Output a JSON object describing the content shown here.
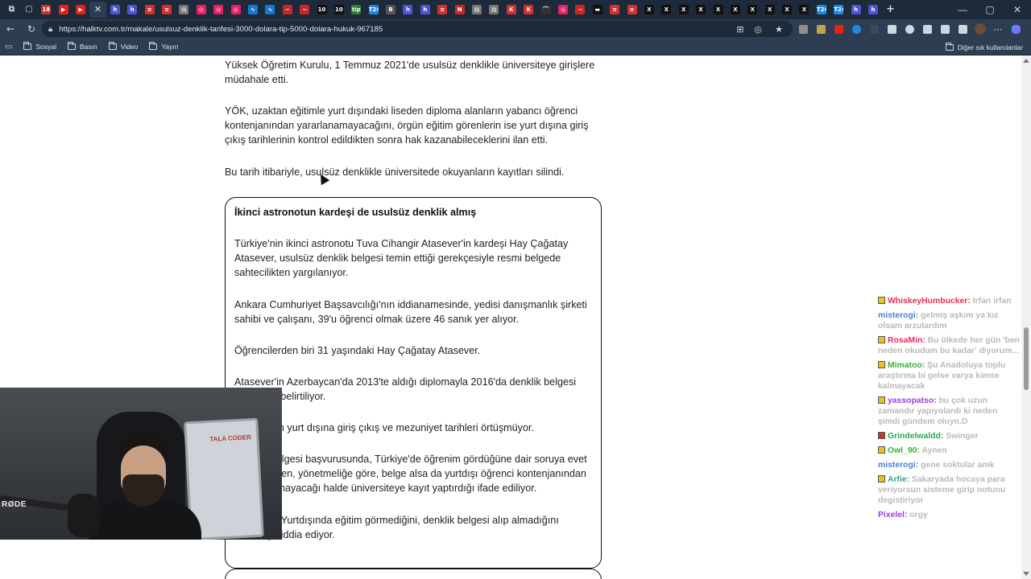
{
  "browser": {
    "url": "https://halktv.com.tr/makale/usulsuz-denklik-tarifesi-3000-dolara-tip-5000-dolara-hukuk-967185",
    "tabs": [
      {
        "glyph": "18",
        "color": "#c0392b"
      },
      {
        "glyph": "▶",
        "color": "#e62117"
      },
      {
        "glyph": "▶",
        "color": "#e62117"
      },
      {
        "glyph": "✕",
        "color": "transparent",
        "active": true
      },
      {
        "glyph": "h",
        "color": "#4a55d6"
      },
      {
        "glyph": "h",
        "color": "#4a55d6"
      },
      {
        "glyph": "≡",
        "color": "#d32f2f"
      },
      {
        "glyph": "≡",
        "color": "#d32f2f"
      },
      {
        "glyph": "▤",
        "color": "#777"
      },
      {
        "glyph": "◎",
        "color": "#e91e63"
      },
      {
        "glyph": "◎",
        "color": "#e91e63"
      },
      {
        "glyph": "◎",
        "color": "#e91e63"
      },
      {
        "glyph": "∿",
        "color": "#1976d2"
      },
      {
        "glyph": "∿",
        "color": "#1976d2"
      },
      {
        "glyph": "~",
        "color": "#c62828"
      },
      {
        "glyph": "~",
        "color": "#c62828"
      },
      {
        "glyph": "10",
        "color": "#111"
      },
      {
        "glyph": "10",
        "color": "#111"
      },
      {
        "glyph": "tip",
        "color": "#2e7d32"
      },
      {
        "glyph": "T24",
        "color": "#1e88e5"
      },
      {
        "glyph": "B",
        "color": "#555"
      },
      {
        "glyph": "h",
        "color": "#4a55d6"
      },
      {
        "glyph": "h",
        "color": "#4a55d6"
      },
      {
        "glyph": "≡",
        "color": "#d32f2f"
      },
      {
        "glyph": "N",
        "color": "#c62828"
      },
      {
        "glyph": "▤",
        "color": "#777"
      },
      {
        "glyph": "▤",
        "color": "#777"
      },
      {
        "glyph": "K",
        "color": "#d32f2f"
      },
      {
        "glyph": "K",
        "color": "#d32f2f"
      },
      {
        "glyph": "⌒",
        "color": "#333"
      },
      {
        "glyph": "◎",
        "color": "#e91e63"
      },
      {
        "glyph": "~",
        "color": "#c62828"
      },
      {
        "glyph": "▬",
        "color": "#111"
      },
      {
        "glyph": "≡",
        "color": "#d32f2f"
      },
      {
        "glyph": "≡",
        "color": "#d32f2f"
      },
      {
        "glyph": "X",
        "color": "#111"
      },
      {
        "glyph": "X",
        "color": "#111"
      },
      {
        "glyph": "X",
        "color": "#111"
      },
      {
        "glyph": "X",
        "color": "#111"
      },
      {
        "glyph": "X",
        "color": "#111"
      },
      {
        "glyph": "X",
        "color": "#111"
      },
      {
        "glyph": "X",
        "color": "#111"
      },
      {
        "glyph": "X",
        "color": "#111"
      },
      {
        "glyph": "X",
        "color": "#111"
      },
      {
        "glyph": "X",
        "color": "#111"
      },
      {
        "glyph": "T24",
        "color": "#1e88e5"
      },
      {
        "glyph": "T24",
        "color": "#1e88e5"
      },
      {
        "glyph": "h",
        "color": "#4a55d6"
      },
      {
        "glyph": "h",
        "color": "#4a55d6"
      }
    ],
    "new_tab": "+",
    "bookmarks": [
      "Sosyal",
      "Basın",
      "Video",
      "Yayın"
    ],
    "other_bookmarks": "Diğer sık kullanılanlar"
  },
  "article": {
    "p1": "Yüksek Öğretim Kurulu, 1 Temmuz 2021'de usulsüz denklikle üniversiteye girişlere müdahale etti.",
    "p2": "YÖK, uzaktan eğitimle yurt dışındaki liseden diploma alanların yabancı öğrenci kontenjanından yararlanamayacağını, örgün eğitim görenlerin ise yurt dışına giriş çıkış tarihlerinin kontrol edildikten sonra hak kazanabileceklerini ilan etti.",
    "p3": "Bu tarih itibariyle, usulsüz denklikle üniversitede okuyanların kayıtları silindi.",
    "box": {
      "title": "İkinci astronotun kardeşi de usulsüz denklik almış",
      "p1": "Türkiye'nin ikinci astronotu Tuva Cihangir Atasever'in kardeşi Hay Çağatay Atasever, usulsüz denklik belgesi temin ettiği gerekçesiyle resmi belgede sahtecilikten yargılanıyor.",
      "p2": "Ankara Cumhuriyet Başsavcılığı'nın iddianamesinde, yedisi danışmanlık şirketi sahibi ve çalışanı, 39'u öğrenci olmak üzere 46 sanık yer alıyor.",
      "p3": "Öğrencilerden biri 31 yaşındaki Hay Çağatay Atasever.",
      "p4": "Atasever'in Azerbaycan'da 2013'te aldığı diplomayla 2016'da denklik belgesi elde ettiği belirtiliyor.",
      "p5": "Atasever'in yurt dışına giriş çıkış ve mezuniyet tarihleri örtüşmüyor.",
      "p6": "Denklik belgesi başvurusunda, Türkiye'de öğrenim gördüğüne dair soruya evet cevabı veren, yönetmeliğe göre, belge alsa da yurtdışı öğrenci kontenjanından yararlanamayacağı halde üniversiteye kayıt yaptırdığı ifade ediliyor.",
      "p7": "Atasever \"Yurtdışında eğitim görmediğini, denklik belgesi alıp almadığını bilmediği\" iddia ediyor."
    }
  },
  "chat": [
    {
      "user": "WhiskeyHumbucker",
      "color": "#e8304a",
      "text": "Irfan irfan",
      "badge": "#e6c228"
    },
    {
      "user": "misterogi",
      "color": "#4d7fd1",
      "text": "gelmiş aşkım ya kız olsam arzulardım",
      "badge": ""
    },
    {
      "user": "RosaMin",
      "color": "#e0305a",
      "text": "Bu ülkede her gün 'ben neden okudum bu kadar' diyorum...",
      "badge": "#e6c228"
    },
    {
      "user": "Mimatoo",
      "color": "#3fae3f",
      "text": "Şu Anadoluya toplu araştırma bi gelse varya kimse kalmayacak",
      "badge": "#e6c228"
    },
    {
      "user": "yassopatso",
      "color": "#9b3fd6",
      "text": "bu çok uzun zamandır yapıyolardı ki neden şimdi gündem oluyo.D",
      "badge": "#e6c228"
    },
    {
      "user": "Grindelwaldd",
      "color": "#2fa84f",
      "text": "Swinger",
      "badge": "#c0392b"
    },
    {
      "user": "Owl_90",
      "color": "#3fae3f",
      "text": "Aynen",
      "badge": "#e6c228"
    },
    {
      "user": "misterogi",
      "color": "#4d7fd1",
      "text": "gene soktular amk",
      "badge": ""
    },
    {
      "user": "Arfie",
      "color": "#2fa88f",
      "text": "Sakaryada hocaya para veriyorsun sisteme girip notunu degistiriyor",
      "badge": "#e6c228"
    },
    {
      "user": "Pixelel",
      "color": "#9b3fd6",
      "text": "orgy",
      "badge": ""
    }
  ],
  "webcam": {
    "mic_label": "RØDE",
    "board_text": "TALA CODER"
  }
}
